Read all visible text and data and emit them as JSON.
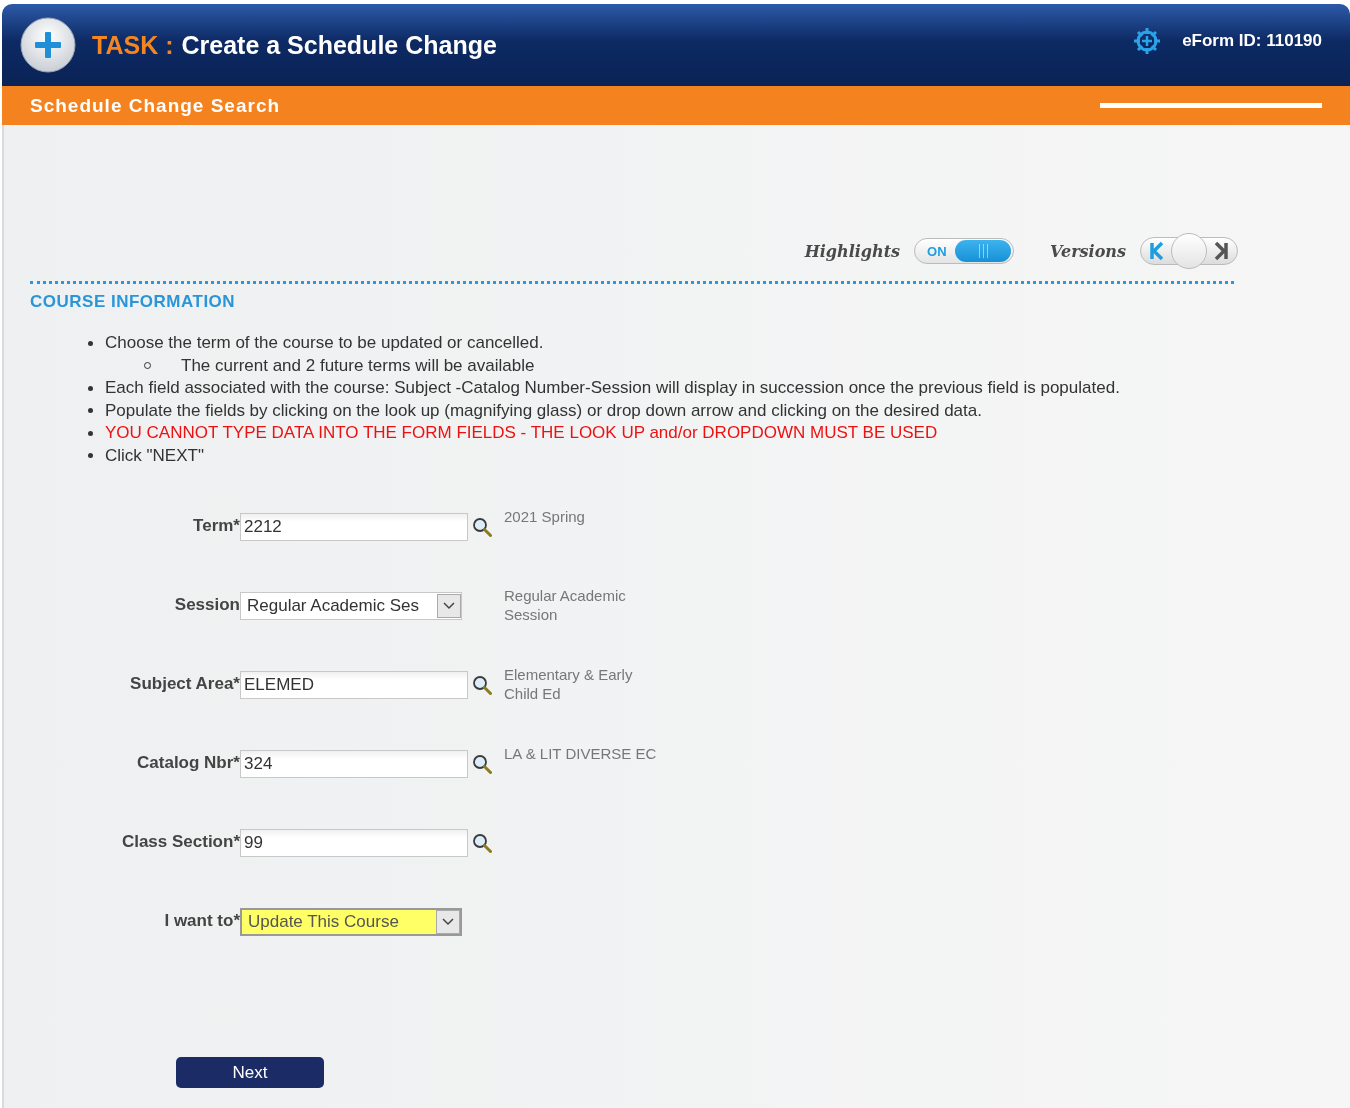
{
  "header": {
    "task_label": "TASK :",
    "title": "Create a Schedule Change",
    "eform_id": "eForm ID: 110190"
  },
  "subheader": {
    "title": "Schedule Change Search"
  },
  "toggles": {
    "highlights": {
      "label": "Highlights",
      "on": true,
      "state_text": "ON"
    },
    "versions": {
      "label": "Versions",
      "level": 0.5
    }
  },
  "section": {
    "title": "COURSE INFORMATION",
    "instructions": [
      {
        "text": "Choose the term of the course to be updated or cancelled.",
        "kind": "normal",
        "children": [
          {
            "text": "The current and 2 future terms will be available",
            "kind": "normal"
          }
        ]
      },
      {
        "text": "Each field associated with the course: Subject -Catalog Number-Session will display in succession once the previous field is populated.",
        "kind": "normal"
      },
      {
        "text": "Populate the fields by clicking on the look up (magnifying glass) or drop down arrow and clicking on the desired data.",
        "kind": "normal"
      },
      {
        "text": "YOU CANNOT TYPE DATA INTO THE FORM FIELDS - THE LOOK UP and/or DROPDOWN MUST BE USED",
        "kind": "alert"
      },
      {
        "text": "Click \"NEXT\"",
        "kind": "normal"
      }
    ]
  },
  "fields": [
    {
      "label": "Term*",
      "kind": "lookup",
      "value": "2212",
      "description": "2021 Spring",
      "highlighted": false
    },
    {
      "label": "Session",
      "kind": "select",
      "value": "Regular Academic Ses",
      "description": "Regular Academic Session",
      "highlighted": false
    },
    {
      "label": "Subject Area*",
      "kind": "lookup",
      "value": "ELEMED",
      "description": "Elementary & Early Child Ed",
      "highlighted": false
    },
    {
      "label": "Catalog Nbr*",
      "kind": "lookup",
      "value": "324",
      "description": "LA & LIT DIVERSE EC",
      "highlighted": false
    },
    {
      "label": "Class Section*",
      "kind": "lookup",
      "value": "99",
      "highlighted": false
    },
    {
      "label": "I want to*",
      "kind": "select",
      "value": "Update This Course",
      "highlighted": true
    }
  ],
  "buttons": [
    {
      "label": "Next"
    }
  ]
}
